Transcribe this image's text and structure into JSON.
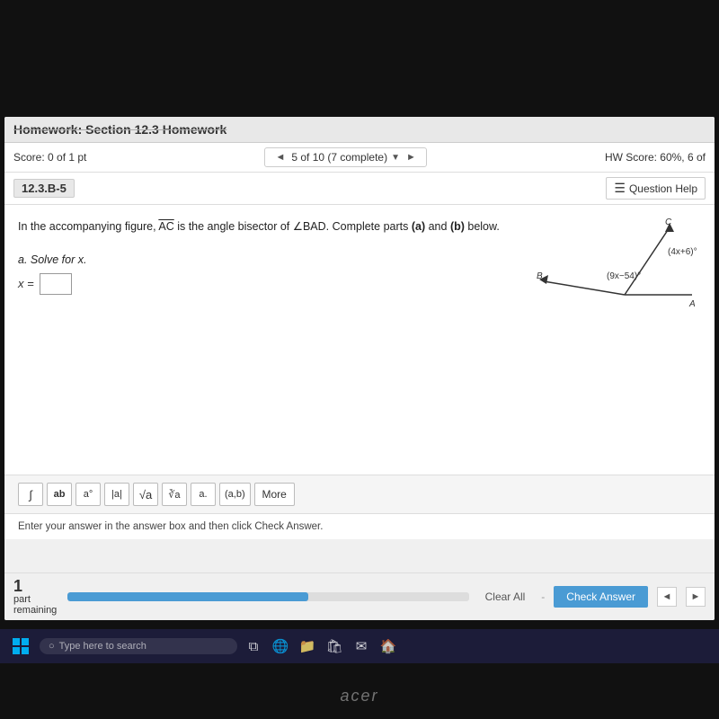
{
  "header": {
    "title": "Homework: Section 12.3 Homework"
  },
  "score_bar": {
    "score_label": "Score: 0 of 1 pt",
    "nav_prev": "◄",
    "nav_text": "5 of 10 (7 complete)",
    "nav_dropdown": "▼",
    "nav_next": "►",
    "hw_score": "HW Score: 60%, 6 of"
  },
  "question_bar": {
    "question_id": "12.3.B-5",
    "help_label": "Question Help"
  },
  "problem": {
    "text": "In the accompanying figure, AC is the angle bisector of ∠BAD. Complete parts (a) and (b) below.",
    "angle1_label": "(4x+6)°",
    "angle2_label": "(9x−54)°",
    "point_b": "B",
    "point_a": "A",
    "point_c": "C"
  },
  "solve_section": {
    "label": "a. Solve for x.",
    "x_label": "x =",
    "input_placeholder": ""
  },
  "toolbar": {
    "buttons": [
      {
        "label": "∫",
        "title": "integral"
      },
      {
        "label": "ab",
        "title": "fraction"
      },
      {
        "label": "a°",
        "title": "degree"
      },
      {
        "label": "|a|",
        "title": "absolute-value"
      },
      {
        "label": "√a",
        "title": "square-root"
      },
      {
        "label": "∛a",
        "title": "cube-root"
      },
      {
        "label": "a.",
        "title": "decimal"
      },
      {
        "label": "(a,b)",
        "title": "coordinates"
      }
    ],
    "more_label": "More"
  },
  "instruction": {
    "text": "Enter your answer in the answer box and then click Check Answer."
  },
  "bottom_bar": {
    "part_label": "part",
    "remaining_label": "remaining",
    "part_number": "1",
    "clear_all_label": "Clear All",
    "separator": "-",
    "check_answer_label": "Check Answer"
  },
  "taskbar": {
    "search_placeholder": "Type here to search",
    "acer_label": "acer"
  },
  "colors": {
    "progress_fill": "#4a9bd4",
    "check_answer_bg": "#4a9bd4",
    "taskbar_bg": "#1e1e3c"
  }
}
